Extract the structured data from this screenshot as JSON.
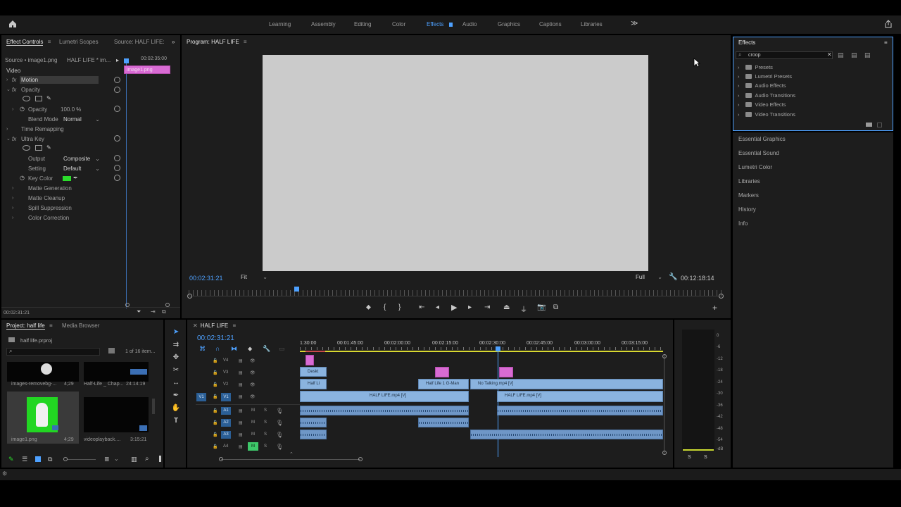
{
  "header": {
    "workspaces": [
      "Learning",
      "Assembly",
      "Editing",
      "Color",
      "Effects",
      "Audio",
      "Graphics",
      "Captions",
      "Libraries"
    ],
    "active_workspace": "Effects",
    "more": "≫"
  },
  "effect_controls": {
    "tabs": [
      "Effect Controls",
      "Lumetri Scopes",
      "Source: HALF LIFE:"
    ],
    "source_label": "Source • image1.png",
    "sequence_label": "HALF LIFE * im...",
    "time_ruler": "00:02:35:00",
    "clip_label": "image1.png",
    "section": "Video",
    "motion": "Motion",
    "opacity_group": "Opacity",
    "opacity_label": "Opacity",
    "opacity_value": "100.0 %",
    "blend_mode_label": "Blend Mode",
    "blend_mode_value": "Normal",
    "time_remapping": "Time Remapping",
    "ultra_key": "Ultra Key",
    "output_label": "Output",
    "output_value": "Composite",
    "setting_label": "Setting",
    "setting_value": "Default",
    "key_color_label": "Key Color",
    "matte_generation": "Matte Generation",
    "matte_cleanup": "Matte Cleanup",
    "spill_suppression": "Spill Suppression",
    "color_correction": "Color Correction",
    "bottom_timecode": "00:02:31:21",
    "key_color": "#2bdc2b"
  },
  "program": {
    "title": "Program: HALF LIFE",
    "timecode": "00:02:31:21",
    "fit": "Fit",
    "quality": "Full",
    "duration": "00:12:18:14"
  },
  "effects_panel": {
    "title": "Effects",
    "search_value": "croop",
    "folders": [
      "Presets",
      "Lumetri Presets",
      "Audio Effects",
      "Audio Transitions",
      "Video Effects",
      "Video Transitions"
    ]
  },
  "side_panels": [
    "Essential Graphics",
    "Essential Sound",
    "Lumetri Color",
    "Libraries",
    "Markers",
    "History",
    "Info"
  ],
  "project": {
    "tabs": [
      "Project: half life",
      "Media Browser"
    ],
    "file": "half life.prproj",
    "count": "1 of 16 item...",
    "items": [
      {
        "name": "images-removebg-...",
        "duration": "4;29"
      },
      {
        "name": "Half-Life _ Chap...",
        "duration": "24:14:19"
      },
      {
        "name": "image1.png",
        "duration": "4;29"
      },
      {
        "name": "videoplayback....",
        "duration": "3:15:21"
      }
    ]
  },
  "timeline": {
    "title": "HALF LIFE",
    "timecode": "00:02:31:21",
    "ruler": [
      "1:30:00",
      "00:01:45:00",
      "00:02:00:00",
      "00:02:15:00",
      "00:02:30:00",
      "00:02:45:00",
      "00:03:00:00",
      "00:03:15:00"
    ],
    "video_tracks": [
      "V4",
      "V3",
      "V2",
      "V1"
    ],
    "audio_tracks": [
      "A1",
      "A2",
      "A3",
      "A4"
    ],
    "v1_source": "V1",
    "clips": {
      "v3_a": "Deskt",
      "v2_a": "Half Li",
      "v2_b": "Half Life 1 G-Man",
      "v2_c": "No Talking.mp4 [V]",
      "v1_a": "HALF LIFE.mp4 [V]",
      "v1_b": "HALF LIFE.mp4 [V]"
    }
  },
  "meter": {
    "scale": [
      "0",
      "-6",
      "-12",
      "-18",
      "-24",
      "-30",
      "-36",
      "-42",
      "-48",
      "-54",
      "-dB"
    ],
    "solo": [
      "S",
      "S"
    ]
  }
}
